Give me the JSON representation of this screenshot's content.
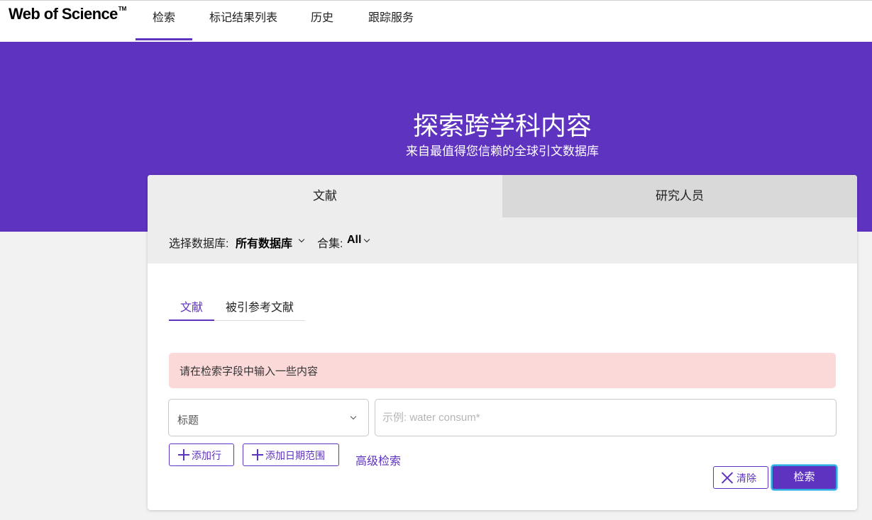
{
  "brand": {
    "logo": "Web of Science",
    "trademark": "TM"
  },
  "nav": {
    "items": [
      {
        "label": "检索",
        "active": true
      },
      {
        "label": "标记结果列表",
        "active": false
      },
      {
        "label": "历史",
        "active": false
      },
      {
        "label": "跟踪服务",
        "active": false
      }
    ]
  },
  "hero": {
    "title": "探索跨学科内容",
    "subtitle": "来自最值得您信赖的全球引文数据库"
  },
  "card": {
    "tabs": [
      {
        "label": "文献",
        "active": true
      },
      {
        "label": "研究人员",
        "active": false
      }
    ],
    "database": {
      "label": "选择数据库:",
      "value": "所有数据库"
    },
    "collection": {
      "label": "合集:",
      "value": "All"
    },
    "subtabs": [
      {
        "label": "文献",
        "active": true
      },
      {
        "label": "被引参考文献",
        "active": false
      }
    ],
    "alert": "请在检索字段中输入一些内容",
    "field": {
      "value": "标题"
    },
    "search": {
      "value": "",
      "placeholder": "示例: water consum*"
    },
    "buttons": {
      "add_row": "添加行",
      "add_date": "添加日期范围",
      "advanced": "高级检索",
      "clear": "清除",
      "search": "检索"
    }
  },
  "colors": {
    "primary": "#5e33bf",
    "alert_bg": "#fcd9d9",
    "focus": "#2fa9e0"
  }
}
